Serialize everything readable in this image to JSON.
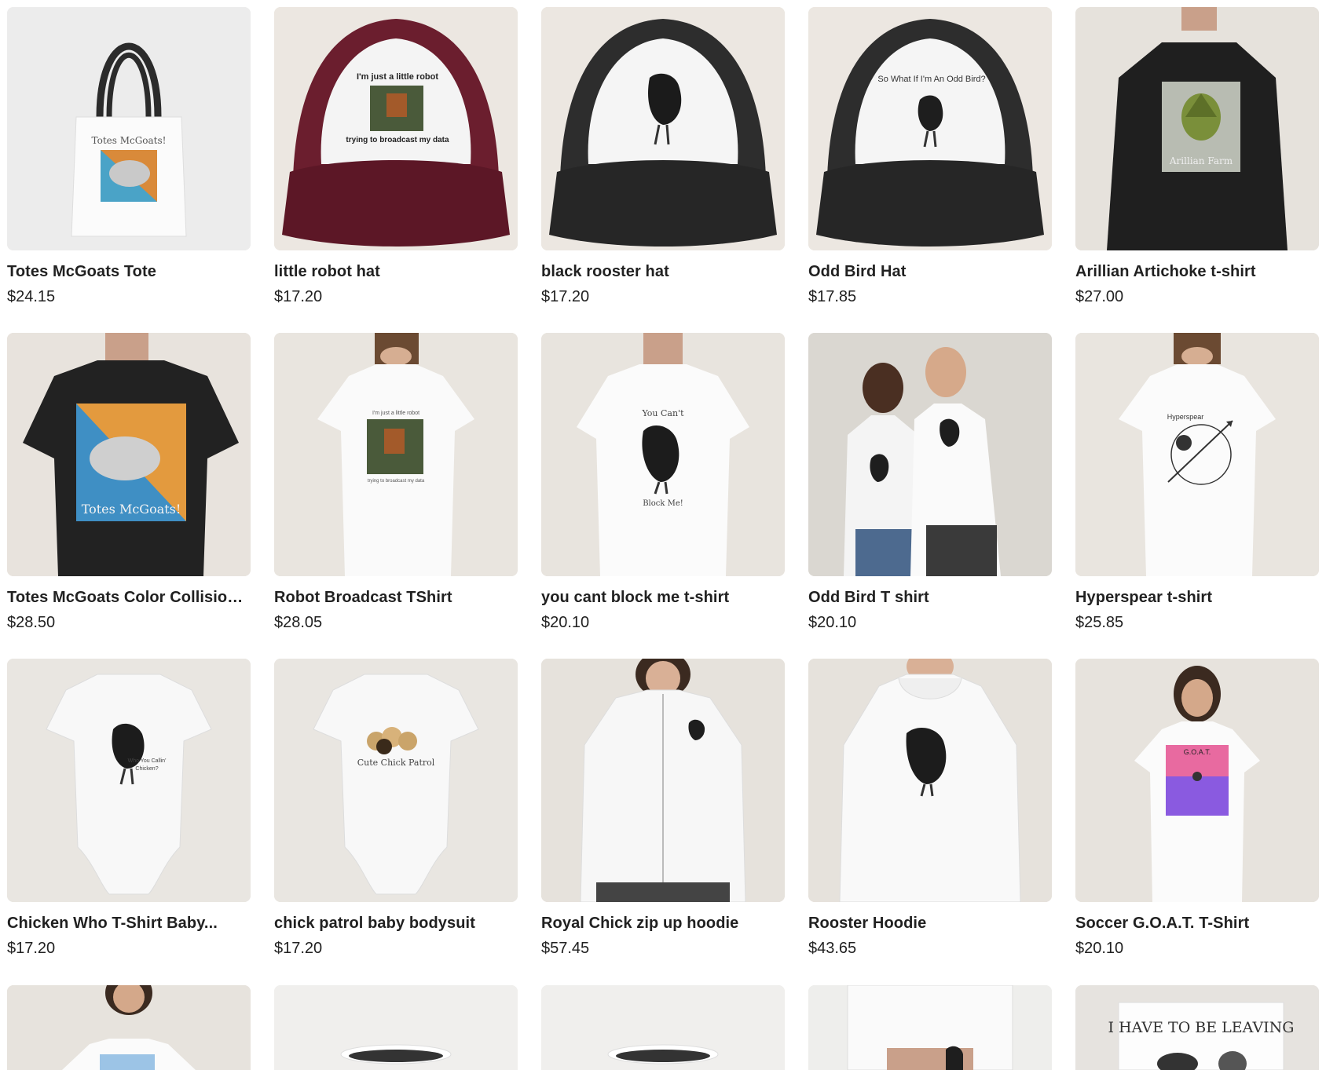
{
  "products": [
    {
      "name": "Totes McGoats Tote",
      "price": "$24.15",
      "art": "tote",
      "print": "Totes McGoats!"
    },
    {
      "name": "little robot hat",
      "price": "$17.20",
      "art": "hat-maroon",
      "print_top": "I'm just a little robot",
      "print_bottom": "trying to broadcast my data"
    },
    {
      "name": "black rooster hat",
      "price": "$17.20",
      "art": "hat-black"
    },
    {
      "name": "Odd Bird Hat",
      "price": "$17.85",
      "art": "hat-oddbird",
      "print": "So What If I'm An Odd Bird?"
    },
    {
      "name": "Arillian Artichoke t-shirt",
      "price": "$27.00",
      "art": "tee-artichoke",
      "print": "Arillian Farm"
    },
    {
      "name": "Totes McGoats Color Collision ...",
      "price": "$28.50",
      "art": "tee-goat",
      "print": "Totes McGoats!"
    },
    {
      "name": "Robot Broadcast TShirt",
      "price": "$28.05",
      "art": "tee-robot",
      "print_top": "I'm just a little robot",
      "print_bottom": "trying to broadcast my data"
    },
    {
      "name": "you cant block me t-shirt",
      "price": "$20.10",
      "art": "tee-block",
      "print_top": "You Can't",
      "print_bottom": "Block Me!"
    },
    {
      "name": "Odd Bird T shirt",
      "price": "$20.10",
      "art": "tee-couple"
    },
    {
      "name": "Hyperspear t-shirt",
      "price": "$25.85",
      "art": "tee-hyperspear",
      "print": "Hyperspear"
    },
    {
      "name": "Chicken Who T-Shirt Baby...",
      "price": "$17.20",
      "art": "onesie-chicken",
      "print_top": "Who You Callin'",
      "print_bottom": "Chicken?"
    },
    {
      "name": "chick patrol baby bodysuit",
      "price": "$17.20",
      "art": "onesie-chicks",
      "print": "Cute Chick Patrol"
    },
    {
      "name": "Royal Chick zip up hoodie",
      "price": "$57.45",
      "art": "hoodie-zip"
    },
    {
      "name": "Rooster Hoodie",
      "price": "$43.65",
      "art": "hoodie"
    },
    {
      "name": "Soccer G.O.A.T. T-Shirt",
      "price": "$20.10",
      "art": "tee-soccer",
      "print": "G.O.A.T."
    }
  ],
  "partial_row": [
    {
      "art": "partial-tee"
    },
    {
      "art": "partial-mug"
    },
    {
      "art": "partial-mug"
    },
    {
      "art": "partial-can"
    },
    {
      "art": "partial-card",
      "print": "I HAVE TO BE LEAVING"
    }
  ],
  "colors": {
    "text": "#212121",
    "bg": "#ffffff",
    "thumb_bg": "#ebe7e2"
  }
}
